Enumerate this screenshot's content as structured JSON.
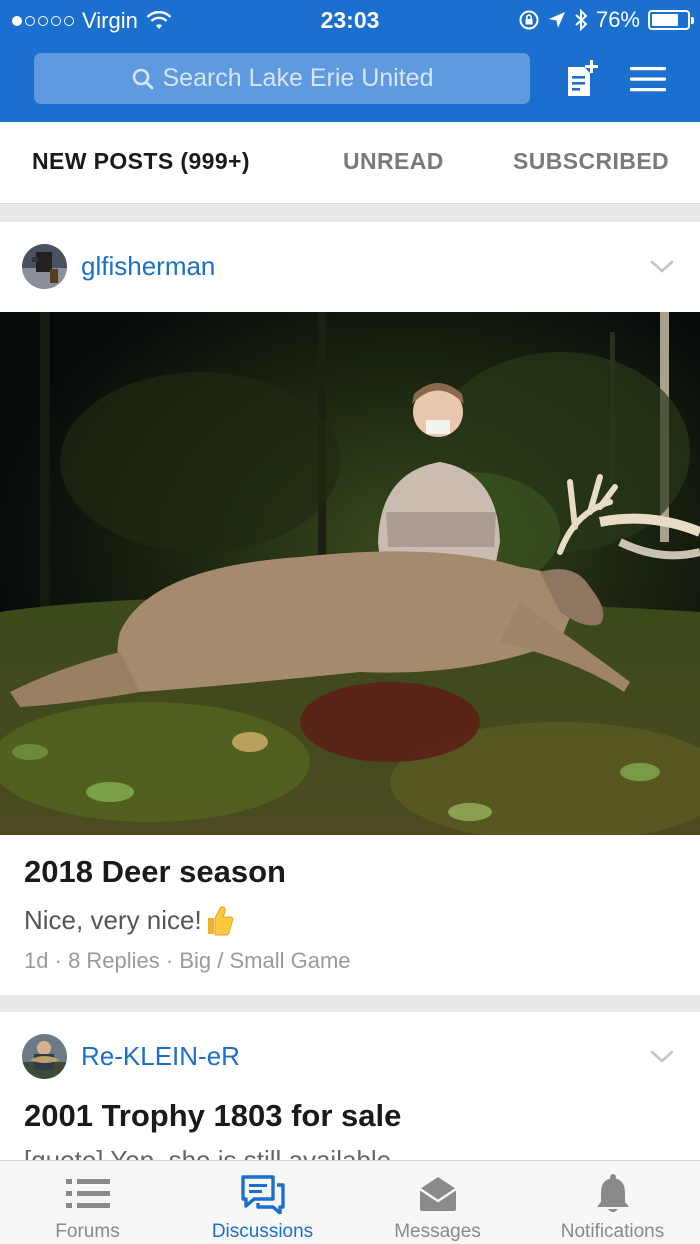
{
  "status_bar": {
    "carrier": "Virgin",
    "time": "23:03",
    "battery": "76%",
    "battery_level": 0.76
  },
  "header": {
    "search_placeholder": "Search Lake Erie United",
    "icons": [
      "search-icon",
      "compose-icon",
      "menu-icon"
    ]
  },
  "tabs": [
    {
      "label": "NEW POSTS (999+)",
      "active": true
    },
    {
      "label": "UNREAD",
      "active": false
    },
    {
      "label": "SUBSCRIBED",
      "active": false
    }
  ],
  "posts": [
    {
      "author": "glfisherman",
      "title": "2018 Deer season",
      "excerpt": "Nice, very nice!",
      "excerpt_emoji": "thumbs-up",
      "age": "1d",
      "replies": "8 Replies",
      "forum": "Big / Small Game"
    },
    {
      "author": "Re-KLEIN-eR",
      "title": "2001 Trophy 1803 for sale",
      "excerpt": "[quote] Yep, she is still available"
    }
  ],
  "bottom_nav": [
    {
      "label": "Forums",
      "icon": "list-icon",
      "active": false
    },
    {
      "label": "Discussions",
      "icon": "chat-icon",
      "active": true
    },
    {
      "label": "Messages",
      "icon": "envelope-icon",
      "active": false
    },
    {
      "label": "Notifications",
      "icon": "bell-icon",
      "active": false
    }
  ],
  "colors": {
    "brand": "#1b6fcf",
    "search_bg": "#5f9ae0",
    "inactive_text": "#8a8a8a"
  }
}
